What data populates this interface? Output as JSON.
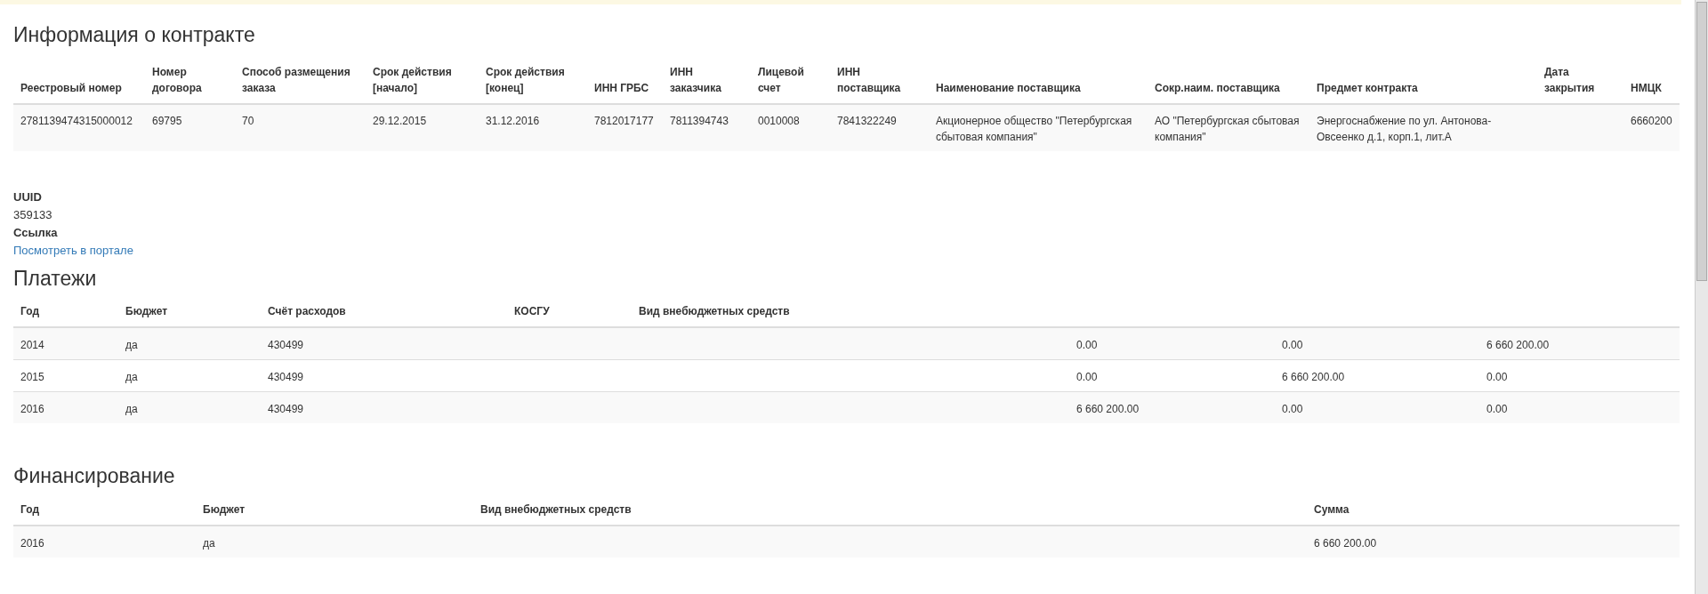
{
  "contract": {
    "title": "Информация о контракте",
    "columns": [
      "Реестровый номер",
      "Номер договора",
      "Способ размещения заказа",
      "Срок действия [начало]",
      "Срок действия [конец]",
      "ИНН ГРБС",
      "ИНН заказчика",
      "Лицевой счет",
      "ИНН поставщика",
      "Наименование поставщика",
      "Сокр.наим. поставщика",
      "Предмет контракта",
      "Дата закрытия",
      "НМЦК"
    ],
    "rows": [
      [
        "2781139474315000012",
        "69795",
        "70",
        "29.12.2015",
        "31.12.2016",
        "7812017177",
        "7811394743",
        "0010008",
        "7841322249",
        "Акционерное общество \"Петербургская сбытовая компания\"",
        "АО \"Петербургская сбытовая компания\"",
        "Энергоснабжение по ул. Антонова-Овсеенко д.1, корп.1, лит.А",
        "",
        "6660200"
      ]
    ]
  },
  "details": [
    {
      "label": "UUID",
      "value": "359133",
      "kind": "text"
    },
    {
      "label": "Ссылка",
      "value": "Посмотреть в портале",
      "kind": "link"
    }
  ],
  "payments": {
    "title": "Платежи",
    "columns": [
      "Год",
      "Бюджет",
      "Счёт расходов",
      "КОСГУ",
      "Вид внебюджетных средств"
    ],
    "rows": [
      [
        "2014",
        "да",
        "430499",
        "",
        "",
        "0.00",
        "0.00",
        "6 660 200.00"
      ],
      [
        "2015",
        "да",
        "430499",
        "",
        "",
        "0.00",
        "6 660 200.00",
        "0.00"
      ],
      [
        "2016",
        "да",
        "430499",
        "",
        "",
        "6 660 200.00",
        "0.00",
        "0.00"
      ]
    ]
  },
  "financing": {
    "title": "Финансирование",
    "columns": [
      "Год",
      "Бюджет",
      "Вид внебюджетных средств",
      "Сумма"
    ],
    "rows": [
      [
        "2016",
        "да",
        "",
        "6 660 200.00"
      ]
    ]
  }
}
